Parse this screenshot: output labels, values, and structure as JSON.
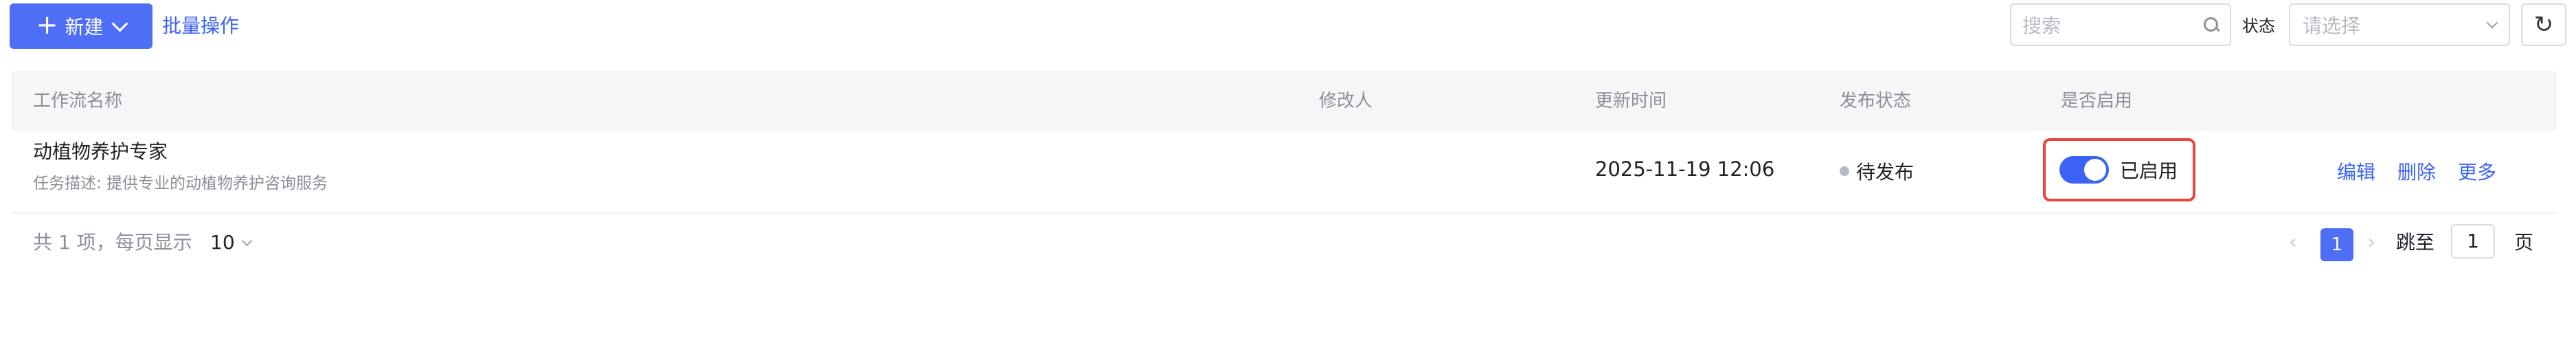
{
  "toolbar": {
    "new_label": "新建",
    "batch_label": "批量操作",
    "search_placeholder": "搜索",
    "status_label": "状态",
    "status_placeholder": "请选择"
  },
  "table": {
    "columns": [
      "工作流名称",
      "修改人",
      "更新时间",
      "发布状态",
      "是否启用"
    ],
    "rows": [
      {
        "name": "动植物养护专家",
        "description": "任务描述: 提供专业的动植物养护咨询服务",
        "modifier": "",
        "updated": "2025-11-19 12:06",
        "publish_status": "待发布",
        "enabled": true,
        "enabled_label": "已启用",
        "actions": [
          "编辑",
          "删除",
          "更多"
        ]
      }
    ]
  },
  "pagination": {
    "total_text": "共 1 项，每页显示",
    "page_size": "10",
    "current_page": "1",
    "jump_label": "跳至",
    "jump_value": "1",
    "page_suffix": "页"
  },
  "colors": {
    "primary": "#4d6ef5",
    "link": "#3b63f6",
    "highlight_border": "#e8473b",
    "header_bg": "#f5f6f8"
  },
  "icons": [
    "plus-icon",
    "chevron-down-icon",
    "search-icon",
    "refresh-icon",
    "chevron-left-icon",
    "chevron-right-icon"
  ]
}
